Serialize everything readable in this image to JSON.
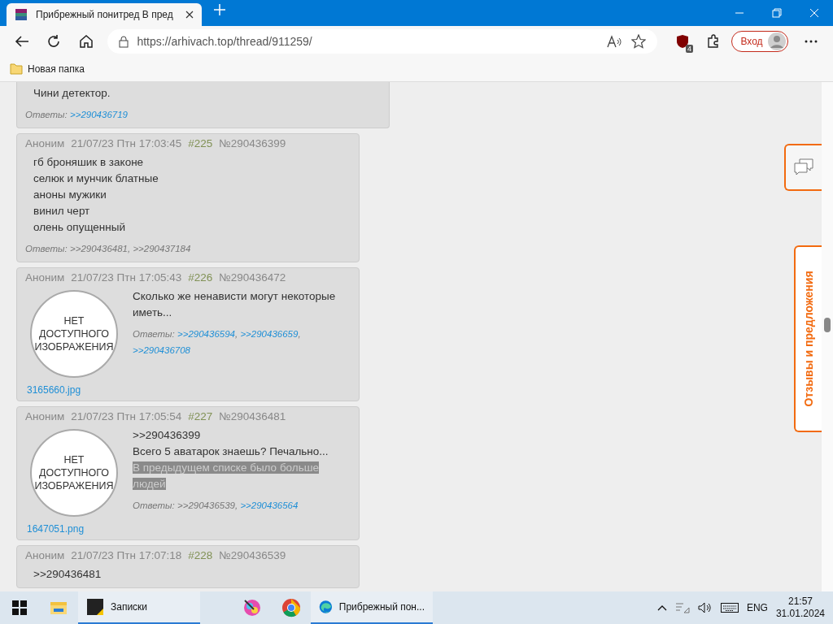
{
  "browser": {
    "tab_title": "Прибрежный понитред В пред",
    "address": "https://arhivach.top/thread/911259/",
    "signin_label": "Вход",
    "extension_badge": "4",
    "bookmarks": [
      {
        "label": "Новая папка"
      }
    ]
  },
  "posts": [
    {
      "kind": "text",
      "partial": true,
      "body": [
        {
          "text": "Чини детектор.",
          "highlighted": false
        }
      ],
      "replies_label": "Ответы:",
      "replies": [
        {
          "text": ">>290436719",
          "visited": false
        }
      ]
    },
    {
      "kind": "text",
      "partial": false,
      "author": "Аноним",
      "date": "21/07/23 Птн 17:03:45",
      "number": "#225",
      "post_id": "№290436399",
      "body": [
        {
          "text": "гб броняшик в законе",
          "highlighted": false
        },
        {
          "text": "селюк и мунчик блатные",
          "highlighted": false
        },
        {
          "text": "аноны мужики",
          "highlighted": false
        },
        {
          "text": "винил черт",
          "highlighted": false
        },
        {
          "text": "олень опущенный",
          "highlighted": false
        }
      ],
      "replies_label": "Ответы:",
      "separator": ",",
      "replies": [
        {
          "text": ">>290436481",
          "visited": true
        },
        {
          "text": ">>290437184",
          "visited": true
        }
      ]
    },
    {
      "kind": "image",
      "partial": false,
      "author": "Аноним",
      "date": "21/07/23 Птн 17:05:43",
      "number": "#226",
      "post_id": "№290436472",
      "image_text": "НЕТ ДОСТУПНОГО ИЗОБРАЖЕНИЯ",
      "file_name": "3165660.jpg",
      "body": [
        {
          "text": "Сколько же ненависти могут некоторые иметь...",
          "highlighted": false
        }
      ],
      "replies_label": "Ответы:",
      "separator": ",",
      "replies": [
        {
          "text": ">>290436594",
          "visited": false
        },
        {
          "text": ">>290436659",
          "visited": false
        },
        {
          "text": ">>290436708",
          "visited": false
        }
      ]
    },
    {
      "kind": "image",
      "partial": false,
      "author": "Аноним",
      "date": "21/07/23 Птн 17:05:54",
      "number": "#227",
      "post_id": "№290436481",
      "image_text": "НЕТ ДОСТУПНОГО ИЗОБРАЖЕНИЯ",
      "file_name": "1647051.png",
      "body": [
        {
          "text": ">>290436399",
          "highlighted": false
        },
        {
          "text": "Всего 5 аватарок знаешь? Печально...",
          "highlighted": false
        },
        {
          "text": "В предыдущем списке было больше людей",
          "highlighted": true
        }
      ],
      "replies_label": "Ответы:",
      "separator": ",",
      "replies": [
        {
          "text": ">>290436539",
          "visited": true
        },
        {
          "text": ">>290436564",
          "visited": false
        }
      ]
    },
    {
      "kind": "text",
      "partial": false,
      "author": "Аноним",
      "date": "21/07/23 Птн 17:07:18",
      "number": "#228",
      "post_id": "№290436539",
      "body": [
        {
          "text": ">>290436481",
          "highlighted": false
        }
      ]
    }
  ],
  "feedback_tab": {
    "label": "Отзывы и предложения"
  },
  "taskbar": {
    "apps": [
      {
        "kind": "explorer",
        "active": false
      },
      {
        "kind": "notes",
        "label": "Записки",
        "active": true
      },
      {
        "kind": "paint",
        "active": false
      },
      {
        "kind": "chrome",
        "active": false
      },
      {
        "kind": "edge",
        "label": "Прибрежный пон...",
        "active": true
      }
    ],
    "language": "ENG",
    "time": "21:57",
    "date": "31.01.2024"
  }
}
